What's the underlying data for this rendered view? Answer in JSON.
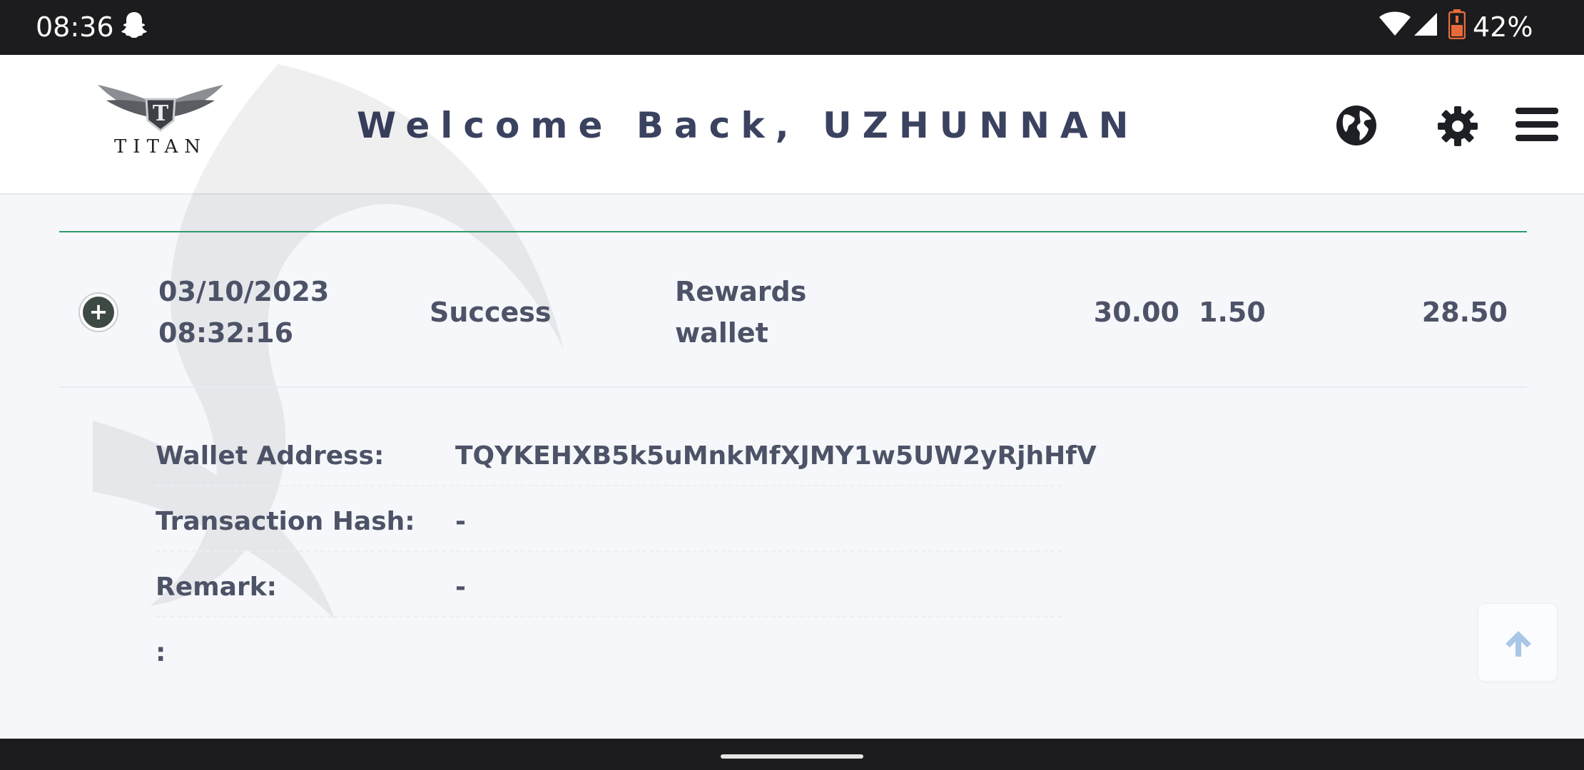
{
  "status_bar": {
    "time": "08:36",
    "battery": "42%",
    "icons": [
      "ghost-icon",
      "wifi-icon",
      "signal-icon",
      "battery-icon"
    ]
  },
  "header": {
    "logo_text": "TITAN",
    "welcome": "Welcome Back, UZHUNNAN",
    "icons": [
      "globe-icon",
      "gear-icon",
      "menu-icon"
    ]
  },
  "transaction": {
    "date": "03/10/2023",
    "time": "08:32:16",
    "status": "Success",
    "wallet_line1": "Rewards",
    "wallet_line2": "wallet",
    "amount": "30.00",
    "fee": "1.50",
    "net": "28.50"
  },
  "details": [
    {
      "label": "Wallet Address:",
      "value": "TQYKEHXB5k5uMnkMfXJMY1w5UW2yRjhHfV"
    },
    {
      "label": "Transaction Hash:",
      "value": "-"
    },
    {
      "label": "Remark:",
      "value": "-"
    },
    {
      "label": ":",
      "value": ""
    }
  ],
  "colors": {
    "accent_line": "#2e9a68",
    "heading": "#3a4260",
    "text": "#4d5367",
    "scroll_arrow": "#a9c6e6"
  }
}
